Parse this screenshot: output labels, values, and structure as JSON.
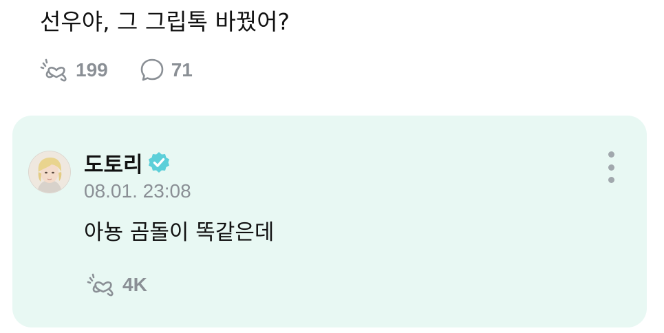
{
  "post": {
    "text": "선우야, 그 그립톡 바꿨어?",
    "stats": {
      "like_icon": "hand-heart-icon",
      "like_count": "199",
      "comment_icon": "speech-bubble-icon",
      "comment_count": "71"
    }
  },
  "comment": {
    "author": "도토리",
    "verified_icon": "verified-badge-icon",
    "timestamp": "08.01. 23:08",
    "text": "아뇽 곰돌이 똑같은데",
    "like_icon": "hand-heart-icon",
    "like_count": "4K",
    "menu_icon": "more-vertical-icon"
  },
  "colors": {
    "card_background": "#e8f8f3",
    "verified_badge": "#5ccfd9",
    "muted_text": "#8a8f95",
    "primary_text": "#111111"
  }
}
